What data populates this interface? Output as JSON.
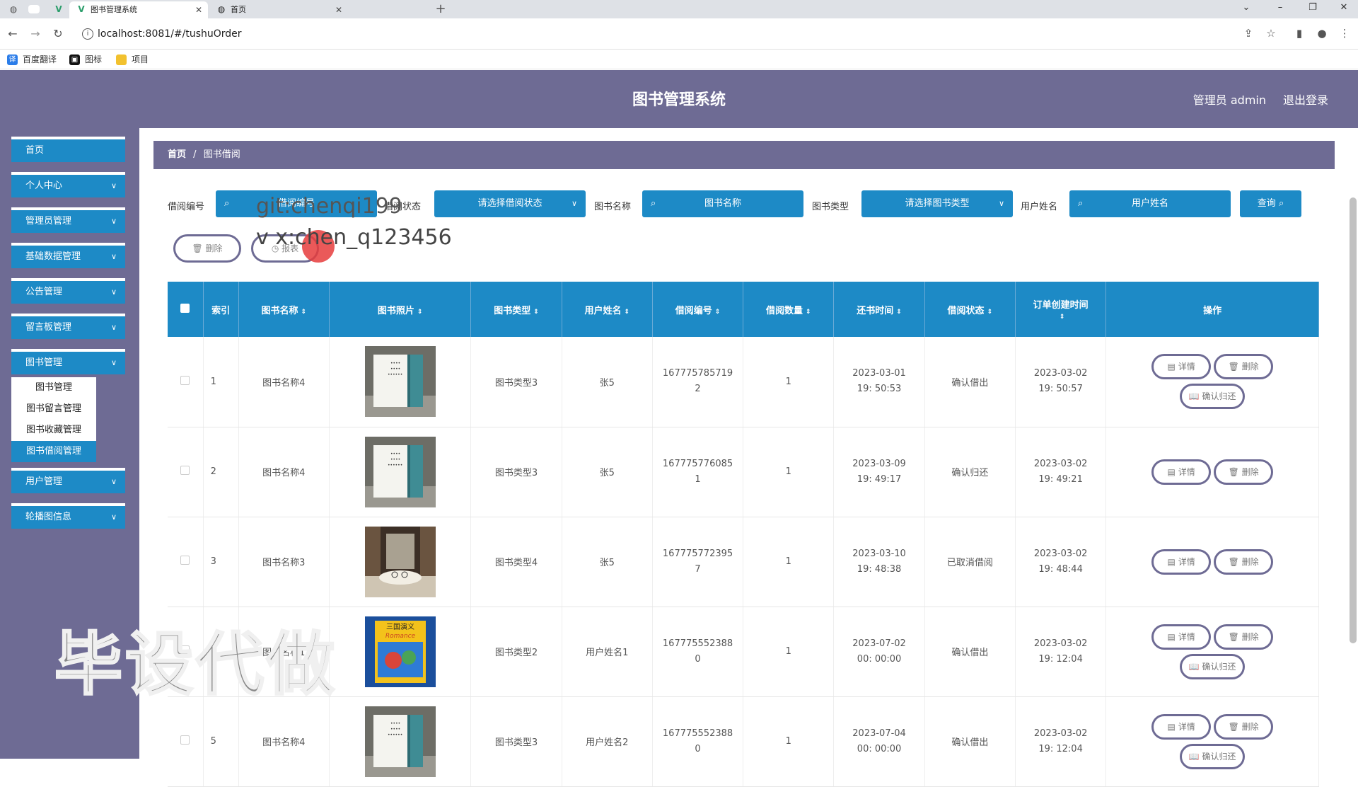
{
  "browser": {
    "tabs": [
      {
        "title": "图书管理系统",
        "active": true
      },
      {
        "title": "首页",
        "active": false
      }
    ],
    "url": "localhost:8081/#/tushuOrder",
    "bookmarks": [
      "百度翻译",
      "图标",
      "项目"
    ]
  },
  "header": {
    "title": "图书管理系统",
    "admin": "管理员 admin",
    "logout": "退出登录"
  },
  "sidebar": {
    "items": [
      "首页",
      "个人中心",
      "管理员管理",
      "基础数据管理",
      "公告管理",
      "留言板管理",
      "图书管理",
      "用户管理",
      "轮播图信息"
    ],
    "submenu": [
      "图书管理",
      "图书留言管理",
      "图书收藏管理",
      "图书借阅管理"
    ]
  },
  "breadcrumb": {
    "home": "首页",
    "sep": "/",
    "current": "图书借阅"
  },
  "filters": {
    "borrow_no_label": "借阅编号",
    "borrow_no_placeholder": "借阅编号",
    "status_label": "借阅状态",
    "status_placeholder": "请选择借阅状态",
    "book_name_label": "图书名称",
    "book_name_placeholder": "图书名称",
    "book_type_label": "图书类型",
    "book_type_placeholder": "请选择图书类型",
    "user_name_label": "用户姓名",
    "user_name_placeholder": "用户姓名",
    "query": "查询"
  },
  "actions": {
    "delete": "删除",
    "report": "报表"
  },
  "watermarks": {
    "line1": "git:chenqi199",
    "line2": "v x:chen_q123456",
    "big": "毕设代做"
  },
  "table": {
    "columns": [
      "索引",
      "图书名称",
      "图书照片",
      "图书类型",
      "用户姓名",
      "借阅编号",
      "借阅数量",
      "还书时间",
      "借阅状态",
      "订单创建时间",
      "操作"
    ],
    "rows": [
      {
        "idx": "1",
        "name": "图书名称4",
        "type": "图书类型3",
        "user": "张5",
        "no": "167775785719 2",
        "qty": "1",
        "ret": "2023-03-01 19: 50:53",
        "status": "确认借出",
        "created": "2023-03-02 19: 50:57",
        "cover": "blue",
        "return_btn": true
      },
      {
        "idx": "2",
        "name": "图书名称4",
        "type": "图书类型3",
        "user": "张5",
        "no": "167775776085 1",
        "qty": "1",
        "ret": "2023-03-09 19: 49:17",
        "status": "确认归还",
        "created": "2023-03-02 19: 49:21",
        "cover": "blue",
        "return_btn": false
      },
      {
        "idx": "3",
        "name": "图书名称3",
        "type": "图书类型4",
        "user": "张5",
        "no": "167775772395 7",
        "qty": "1",
        "ret": "2023-03-10 19: 48:38",
        "status": "已取消借阅",
        "created": "2023-03-02 19: 48:44",
        "cover": "library",
        "return_btn": false
      },
      {
        "idx": "4",
        "name": "图书名称1",
        "type": "图书类型2",
        "user": "用户姓名1",
        "no": "167775552388 0",
        "qty": "1",
        "ret": "2023-07-02 00: 00:00",
        "status": "确认借出",
        "created": "2023-03-02 19: 12:04",
        "cover": "romance",
        "return_btn": true
      },
      {
        "idx": "5",
        "name": "图书名称4",
        "type": "图书类型3",
        "user": "用户姓名2",
        "no": "167775552388 0",
        "qty": "1",
        "ret": "2023-07-04 00: 00:00",
        "status": "确认借出",
        "created": "2023-03-02 19: 12:04",
        "cover": "blue",
        "return_btn": true
      }
    ],
    "op_detail": "详情",
    "op_delete": "删除",
    "op_return": "确认归还"
  },
  "cover_texts": {
    "romance_title": "三国演义",
    "romance_sub": "Romance"
  },
  "colors": {
    "header": "#6e6b94",
    "accent": "#1d8ac6"
  }
}
